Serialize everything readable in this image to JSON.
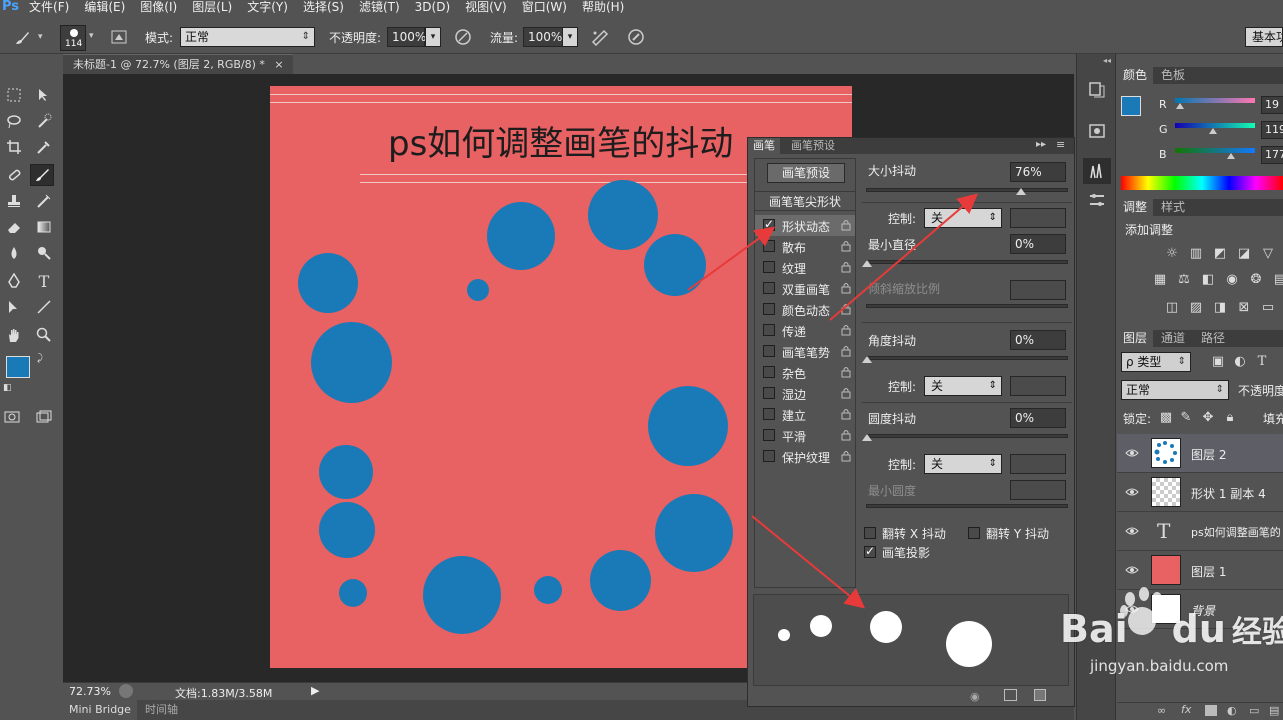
{
  "menu": {
    "logo": "Ps",
    "items": [
      "文件(F)",
      "编辑(E)",
      "图像(I)",
      "图层(L)",
      "文字(Y)",
      "选择(S)",
      "滤镜(T)",
      "3D(D)",
      "视图(V)",
      "窗口(W)",
      "帮助(H)"
    ]
  },
  "options": {
    "brush_size": "114",
    "mode_label": "模式:",
    "mode_value": "正常",
    "opacity_label": "不透明度:",
    "opacity_value": "100%",
    "flow_label": "流量:",
    "flow_value": "100%",
    "workspace": "基本功"
  },
  "document": {
    "tab_title": "未标题-1 @ 72.7% (图层 2, RGB/8) *",
    "canvas_text": "ps如何调整画笔的抖动",
    "zoom": "72.73%",
    "doc_info": "文档:1.83M/3.58M"
  },
  "bottom_tabs": [
    "Mini Bridge",
    "时间轴"
  ],
  "brush_panel": {
    "tabs": [
      "画笔",
      "画笔预设"
    ],
    "preset_button": "画笔预设",
    "tip_shape": "画笔笔尖形状",
    "items": [
      {
        "label": "形状动态",
        "checked": true,
        "selected": true
      },
      {
        "label": "散布",
        "checked": false,
        "selected": false
      },
      {
        "label": "纹理",
        "checked": false,
        "selected": false
      },
      {
        "label": "双重画笔",
        "checked": false,
        "selected": false
      },
      {
        "label": "颜色动态",
        "checked": false,
        "selected": false
      },
      {
        "label": "传递",
        "checked": false,
        "selected": false
      },
      {
        "label": "画笔笔势",
        "checked": false,
        "selected": false
      },
      {
        "label": "杂色",
        "checked": false,
        "selected": false
      },
      {
        "label": "湿边",
        "checked": false,
        "selected": false
      },
      {
        "label": "建立",
        "checked": false,
        "selected": false
      },
      {
        "label": "平滑",
        "checked": false,
        "selected": false
      },
      {
        "label": "保护纹理",
        "checked": false,
        "selected": false
      }
    ],
    "size_jitter_label": "大小抖动",
    "size_jitter_value": "76%",
    "size_jitter_fraction": 0.76,
    "control_label": "控制:",
    "control_value": "关",
    "min_diameter_label": "最小直径",
    "min_diameter_value": "0%",
    "tilt_scale_label": "倾斜缩放比例",
    "angle_jitter_label": "角度抖动",
    "angle_jitter_value": "0%",
    "roundness_jitter_label": "圆度抖动",
    "roundness_jitter_value": "0%",
    "min_roundness_label": "最小圆度",
    "flip_x_label": "翻转 X 抖动",
    "flip_y_label": "翻转 Y 抖动",
    "brush_projection_label": "画笔投影",
    "brush_projection_checked": true
  },
  "color_panel": {
    "tabs": [
      "颜色",
      "色板"
    ],
    "r_label": "R",
    "r_value": "19",
    "g_label": "G",
    "g_value": "119",
    "b_label": "B",
    "b_value": "177"
  },
  "adjust_panel": {
    "tabs": [
      "调整",
      "样式"
    ],
    "add_label": "添加调整"
  },
  "layers_panel": {
    "tabs": [
      "图层",
      "通道",
      "路径"
    ],
    "filter_label": "ρ 类型",
    "blend_mode": "正常",
    "opacity_label": "不透明度",
    "lock_label": "锁定:",
    "fill_label": "填充",
    "layers": [
      {
        "name": "图层 2",
        "selected": true
      },
      {
        "name": "形状 1 副本 4",
        "selected": false
      },
      {
        "name": "ps如何调整画笔的",
        "selected": false
      },
      {
        "name": "图层 1",
        "selected": false
      },
      {
        "name": "背景",
        "selected": false
      }
    ]
  },
  "watermark": {
    "brand": "Bai",
    "brand2": "du",
    "cn": "经验",
    "url": "jingyan.baidu.com"
  },
  "colors": {
    "accent_blue": "#1a7ab7",
    "canvas_red": "#e86163",
    "arrow_red": "#e83a3a"
  }
}
